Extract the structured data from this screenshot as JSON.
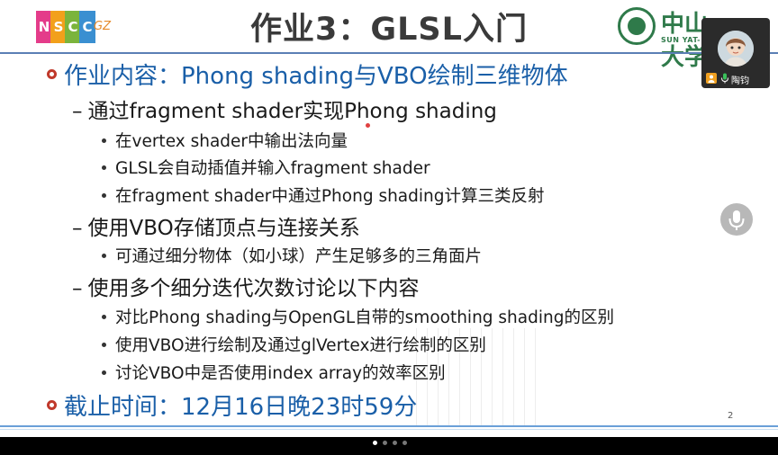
{
  "slide": {
    "logo_left_letters": [
      "N",
      "S",
      "C",
      "C"
    ],
    "logo_left_suffix": "GZ",
    "logo_left_colors": [
      "#e43c8a",
      "#f2a01b",
      "#7bb43c",
      "#3a8fd1"
    ],
    "title": "作业3：GLSL入门",
    "logo_right_name": "中山大学",
    "logo_right_sub": "SUN YAT-",
    "sections": [
      {
        "text": "作业内容：Phong shading与VBO绘制三维物体"
      },
      {
        "text": "截止时间：12月16日晚23时59分"
      }
    ],
    "items": [
      {
        "level": 2,
        "text": "通过fragment shader实现Phong shading"
      },
      {
        "level": 3,
        "text": "在vertex shader中输出法向量"
      },
      {
        "level": 3,
        "text": "GLSL会自动插值并输入fragment shader"
      },
      {
        "level": 3,
        "text": "在fragment shader中通过Phong shading计算三类反射"
      },
      {
        "level": 2,
        "text": "使用VBO存储顶点与连接关系"
      },
      {
        "level": 3,
        "text": "可通过细分物体（如小球）产生足够多的三角面片"
      },
      {
        "level": 2,
        "text": "使用多个细分迭代次数讨论以下内容"
      },
      {
        "level": 3,
        "text": "对比Phong shading与OpenGL自带的smoothing shading的区别"
      },
      {
        "level": 3,
        "text": "使用VBO进行绘制及通过glVertex进行绘制的区别"
      },
      {
        "level": 3,
        "text": "讨论VBO中是否使用index array的效率区别"
      }
    ],
    "page_number": "2",
    "dash": "–"
  },
  "video_panel": {
    "participant_name": "陶钧",
    "user_icon": "user-icon",
    "mic_icon": "microphone-icon"
  },
  "floating_mic": {
    "icon": "microphone-icon"
  },
  "pager": {
    "dots": 4,
    "active": 0
  }
}
